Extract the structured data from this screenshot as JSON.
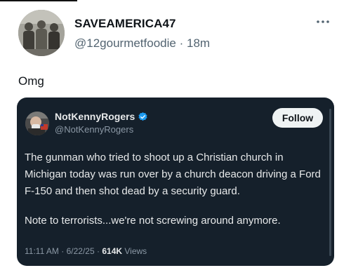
{
  "post": {
    "author": {
      "display_name": "SAVEAMERICA47",
      "handle": "@12gourmetfoodie",
      "separator": "·",
      "time_ago": "18m"
    },
    "more_icon": "more-horizontal-icon",
    "text": "Omg"
  },
  "quoted_post": {
    "author": {
      "display_name": "NotKennyRogers",
      "handle": "@NotKennyRogers",
      "verified_icon": "verified-badge-icon"
    },
    "follow_label": "Follow",
    "paragraphs": [
      "The gunman who tried to shoot up a Christian church in Michigan today was run over by a church deacon driving a Ford F-150 and then shot dead by a security guard.",
      "Note to terrorists...we're not screwing around anymore."
    ],
    "meta": {
      "time": "11:11 AM",
      "separator": "·",
      "date": "6/22/25",
      "views_count": "614K",
      "views_label": "Views"
    }
  },
  "colors": {
    "card_background": "#15202b",
    "verified_blue": "#1d9bf0",
    "secondary_text": "#536471"
  }
}
